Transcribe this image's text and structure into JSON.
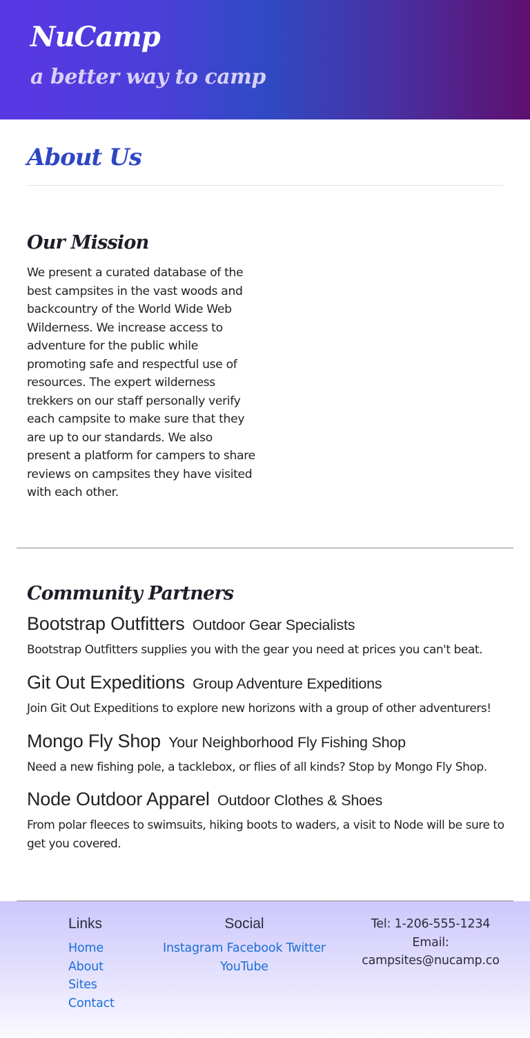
{
  "header": {
    "brand": "NuCamp",
    "tagline": "a better way to camp"
  },
  "about": {
    "title": "About Us"
  },
  "mission": {
    "heading": "Our Mission",
    "text": "We present a curated database of the best campsites in the vast woods and backcountry of the World Wide Web Wilderness. We increase access to adventure for the public while promoting safe and respectful use of resources. The expert wilderness trekkers on our staff personally verify each campsite to make sure that they are up to our standards. We also present a platform for campers to share reviews on campsites they have visited with each other."
  },
  "partners": {
    "heading": "Community Partners",
    "items": [
      {
        "name": "Bootstrap Outfitters",
        "tagline": "Outdoor Gear Specialists",
        "description": "Bootstrap Outfitters supplies you with the gear you need at prices you can't beat."
      },
      {
        "name": "Git Out Expeditions",
        "tagline": "Group Adventure Expeditions",
        "description": "Join Git Out Expeditions to explore new horizons with a group of other adventurers!"
      },
      {
        "name": "Mongo Fly Shop",
        "tagline": "Your Neighborhood Fly Fishing Shop",
        "description": "Need a new fishing pole, a tacklebox, or flies of all kinds? Stop by Mongo Fly Shop."
      },
      {
        "name": "Node Outdoor Apparel",
        "tagline": "Outdoor Clothes & Shoes",
        "description": "From polar fleeces to swimsuits, hiking boots to waders, a visit to Node will be sure to get you covered."
      }
    ]
  },
  "footer": {
    "links_heading": "Links",
    "links": [
      "Home",
      "About",
      "Sites",
      "Contact"
    ],
    "social_heading": "Social",
    "social": [
      "Instagram",
      "Facebook",
      "Twitter",
      "YouTube"
    ],
    "tel": "Tel: 1-206-555-1234",
    "email_label": "Email:",
    "email": "campsites@nucamp.co"
  },
  "colors": {
    "accent": "#2e46c4",
    "link": "#1a6fd6"
  }
}
